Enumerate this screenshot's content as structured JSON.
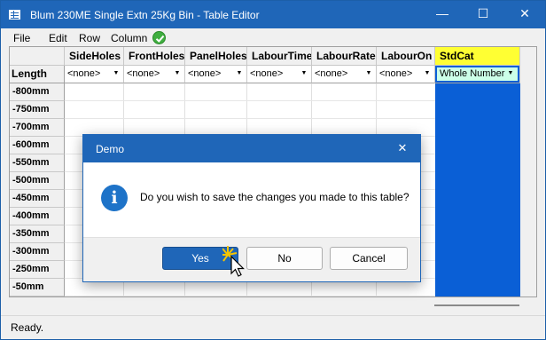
{
  "window": {
    "title": "Blum 230ME Single Extn 25Kg Bin - Table Editor",
    "controls": {
      "minimize": "—",
      "maximize": "☐",
      "close": "✕"
    }
  },
  "menu": {
    "items": [
      "File",
      "Edit",
      "Row",
      "Column"
    ]
  },
  "grid": {
    "columns": [
      "SideHoles",
      "FrontHoles",
      "PanelHoles",
      "LabourTime",
      "LabourRate",
      "LabourOn",
      "StdCat"
    ],
    "row_header_label": "Length",
    "dropdown_values": [
      "<none>",
      "<none>",
      "<none>",
      "<none>",
      "<none>",
      "<none>",
      "Whole Number"
    ],
    "rows": [
      "-800mm",
      "-750mm",
      "-700mm",
      "-600mm",
      "-550mm",
      "-500mm",
      "-450mm",
      "-400mm",
      "-350mm",
      "-300mm",
      "-250mm",
      "-50mm"
    ],
    "colors": {
      "selected_column": "#0a5fd6",
      "stdcat_header": "#ffff33"
    }
  },
  "status": {
    "text": "Ready."
  },
  "dialog": {
    "title": "Demo",
    "close": "✕",
    "icon": "info-icon",
    "icon_glyph": "i",
    "message": "Do you wish to save the changes you made to this table?",
    "buttons": {
      "yes": "Yes",
      "no": "No",
      "cancel": "Cancel"
    }
  }
}
